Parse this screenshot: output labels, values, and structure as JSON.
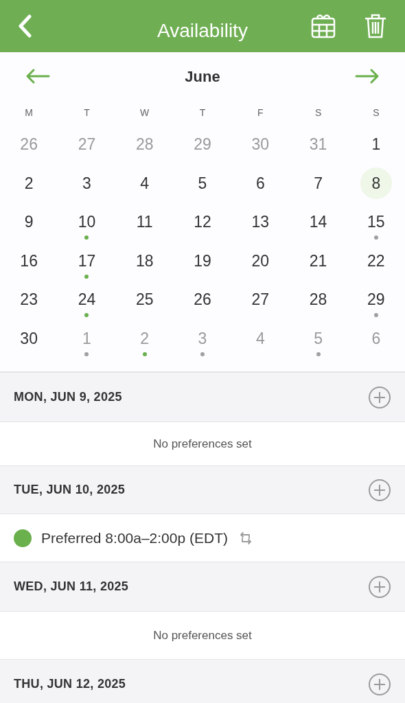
{
  "header": {
    "title": "Availability"
  },
  "calendar": {
    "month": "June",
    "weekdays": [
      "M",
      "T",
      "W",
      "T",
      "F",
      "S",
      "S"
    ],
    "weeks": [
      [
        {
          "label": "26",
          "muted": true,
          "selected": false
        },
        {
          "label": "27",
          "muted": true,
          "selected": false
        },
        {
          "label": "28",
          "muted": true,
          "selected": false
        },
        {
          "label": "29",
          "muted": true,
          "selected": false
        },
        {
          "label": "30",
          "muted": true,
          "selected": false
        },
        {
          "label": "31",
          "muted": true,
          "selected": false
        },
        {
          "label": "1",
          "muted": false,
          "selected": false
        }
      ],
      [
        {
          "label": "2",
          "muted": false,
          "selected": false
        },
        {
          "label": "3",
          "muted": false,
          "selected": false
        },
        {
          "label": "4",
          "muted": false,
          "selected": false
        },
        {
          "label": "5",
          "muted": false,
          "selected": false
        },
        {
          "label": "6",
          "muted": false,
          "selected": false
        },
        {
          "label": "7",
          "muted": false,
          "selected": false
        },
        {
          "label": "8",
          "muted": false,
          "selected": true
        }
      ],
      [
        {
          "label": "9",
          "muted": false,
          "selected": false
        },
        {
          "label": "10",
          "muted": false,
          "selected": false,
          "color": "#6ab04c"
        },
        {
          "label": "11",
          "muted": false,
          "selected": false
        },
        {
          "label": "12",
          "muted": false,
          "selected": false
        },
        {
          "label": "13",
          "muted": false,
          "selected": false
        },
        {
          "label": "14",
          "muted": false,
          "selected": false
        },
        {
          "label": "15",
          "muted": false,
          "selected": false,
          "color": "#a0a0a0"
        }
      ],
      [
        {
          "label": "16",
          "muted": false,
          "selected": false
        },
        {
          "label": "17",
          "muted": false,
          "selected": false,
          "color": "#6ab04c"
        },
        {
          "label": "18",
          "muted": false,
          "selected": false
        },
        {
          "label": "19",
          "muted": false,
          "selected": false
        },
        {
          "label": "20",
          "muted": false,
          "selected": false
        },
        {
          "label": "21",
          "muted": false,
          "selected": false
        },
        {
          "label": "22",
          "muted": false,
          "selected": false
        }
      ],
      [
        {
          "label": "23",
          "muted": false,
          "selected": false
        },
        {
          "label": "24",
          "muted": false,
          "selected": false,
          "color": "#6ab04c"
        },
        {
          "label": "25",
          "muted": false,
          "selected": false
        },
        {
          "label": "26",
          "muted": false,
          "selected": false
        },
        {
          "label": "27",
          "muted": false,
          "selected": false
        },
        {
          "label": "28",
          "muted": false,
          "selected": false
        },
        {
          "label": "29",
          "muted": false,
          "selected": false,
          "color": "#a0a0a0"
        }
      ],
      [
        {
          "label": "30",
          "muted": false,
          "selected": false
        },
        {
          "label": "1",
          "muted": true,
          "selected": false,
          "color": "#a0a0a0"
        },
        {
          "label": "2",
          "muted": true,
          "selected": false,
          "color": "#6ab04c"
        },
        {
          "label": "3",
          "muted": true,
          "selected": false,
          "color": "#a0a0a0"
        },
        {
          "label": "4",
          "muted": true,
          "selected": false
        },
        {
          "label": "5",
          "muted": true,
          "selected": false,
          "color": "#a0a0a0"
        },
        {
          "label": "6",
          "muted": true,
          "selected": false
        }
      ]
    ]
  },
  "days": [
    {
      "title": "MON, JUN 9, 2025",
      "entries": [
        {
          "kind": "empty",
          "text": "No preferences set"
        }
      ]
    },
    {
      "title": "TUE, JUN 10, 2025",
      "entries": [
        {
          "kind": "preference",
          "text": "Preferred 8:00a–2:00p (EDT)",
          "color": "#6ab04c",
          "repeating": true
        }
      ]
    },
    {
      "title": "WED, JUN 11, 2025",
      "entries": [
        {
          "kind": "empty",
          "text": "No preferences set"
        }
      ]
    },
    {
      "title": "THU, JUN 12, 2025"
    }
  ]
}
